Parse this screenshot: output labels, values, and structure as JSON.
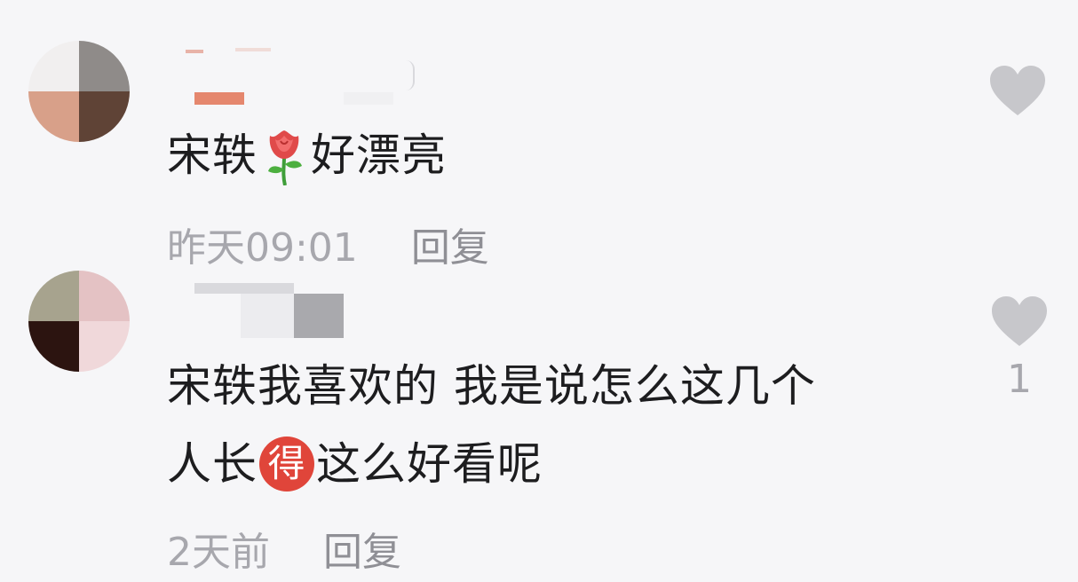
{
  "colors": {
    "background": "#f6f6f8",
    "text": "#1d1d1f",
    "meta": "#a7a7ad",
    "heart": "#c7c7cb",
    "badge": "#e0453a"
  },
  "comments": [
    {
      "text_before_emoji": "宋轶",
      "emoji": "rose-icon",
      "text_after_emoji": "好漂亮",
      "time": "昨天09:01",
      "reply_label": "回复",
      "like_count": ""
    },
    {
      "line1": "宋轶我喜欢的 我是说怎么这几个",
      "line2_before": "人长",
      "badge_char": "得",
      "line2_after": "这么好看呢",
      "time": "2天前",
      "reply_label": "回复",
      "like_count": "1"
    }
  ]
}
